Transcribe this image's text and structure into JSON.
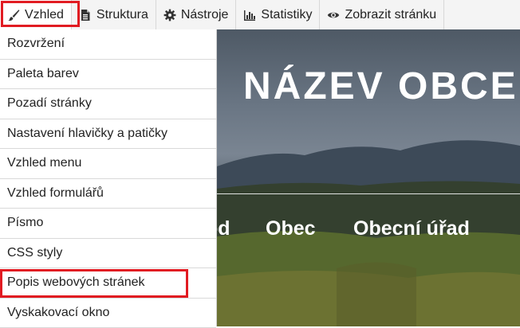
{
  "toolbar": {
    "items": [
      {
        "label": "Vzhled",
        "icon": "brush-icon",
        "active": true
      },
      {
        "label": "Struktura",
        "icon": "document-icon"
      },
      {
        "label": "Nástroje",
        "icon": "gear-icon"
      },
      {
        "label": "Statistiky",
        "icon": "bar-chart-icon"
      },
      {
        "label": "Zobrazit stránku",
        "icon": "eye-icon"
      }
    ]
  },
  "menu": {
    "items": [
      {
        "label": "Rozvržení"
      },
      {
        "label": "Paleta barev"
      },
      {
        "label": "Pozadí stránky"
      },
      {
        "label": "Nastavení hlavičky a patičky"
      },
      {
        "label": "Vzhled menu"
      },
      {
        "label": "Vzhled formulářů"
      },
      {
        "label": "Písmo"
      },
      {
        "label": "CSS styly"
      },
      {
        "label": "Popis webových stránek",
        "highlighted": true
      },
      {
        "label": "Vyskakovací okno"
      }
    ]
  },
  "preview": {
    "title": "NÁZEV OBCE",
    "nav": [
      "od",
      "Obec",
      "Obecní úřad"
    ]
  },
  "colors": {
    "highlight": "#e11b22",
    "toolbar_bg": "#f4f4f4",
    "text": "#222222"
  }
}
